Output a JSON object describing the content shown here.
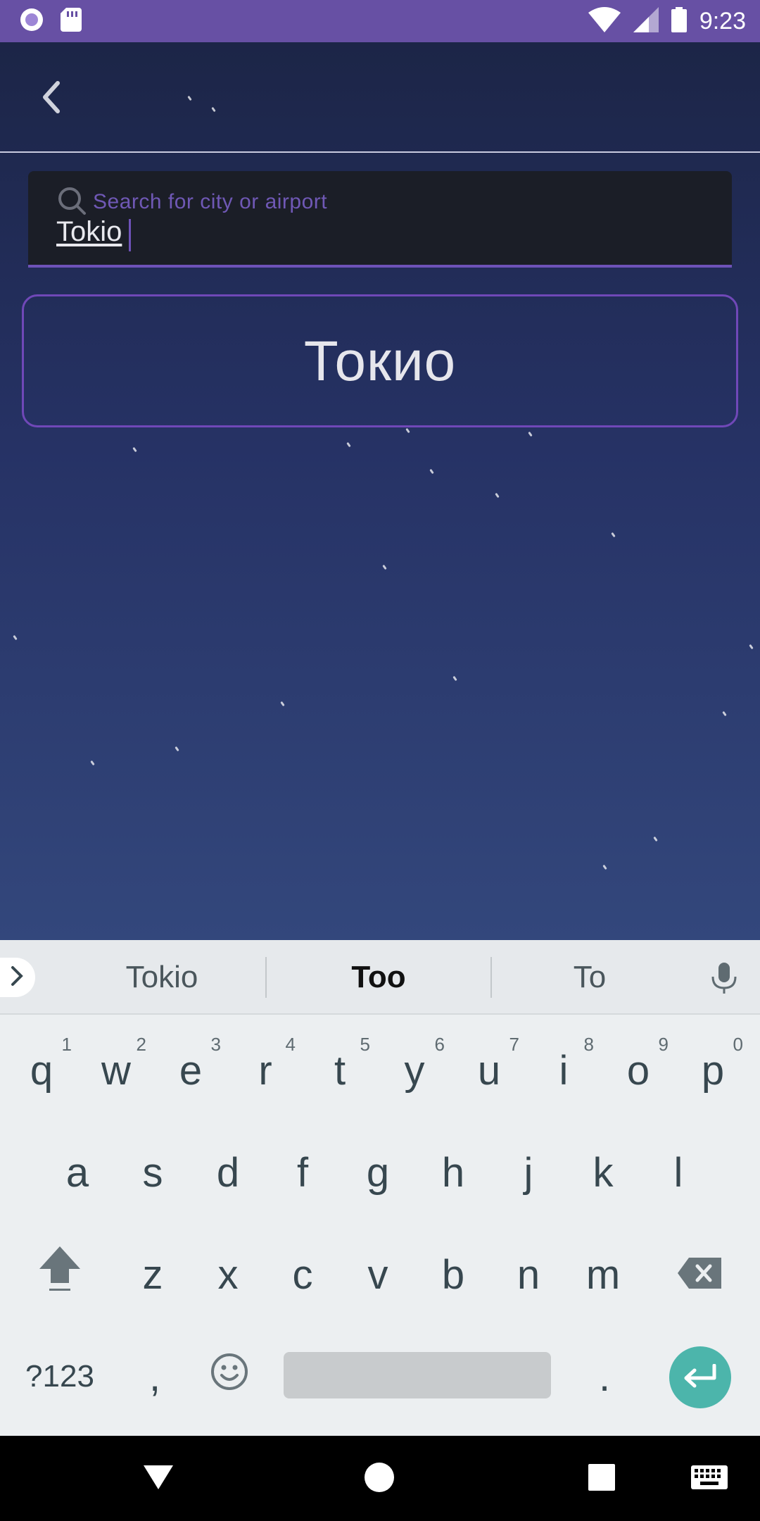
{
  "status_bar": {
    "time": "9:23"
  },
  "header": {
    "back_icon": "chevron-left-icon"
  },
  "search": {
    "placeholder": "Search for city or airport",
    "value": "Tokio"
  },
  "results": [
    {
      "label": "Токио"
    }
  ],
  "keyboard": {
    "suggestions": [
      "Tokio",
      "Too",
      "To"
    ],
    "row1": [
      {
        "k": "q",
        "h": "1"
      },
      {
        "k": "w",
        "h": "2"
      },
      {
        "k": "e",
        "h": "3"
      },
      {
        "k": "r",
        "h": "4"
      },
      {
        "k": "t",
        "h": "5"
      },
      {
        "k": "y",
        "h": "6"
      },
      {
        "k": "u",
        "h": "7"
      },
      {
        "k": "i",
        "h": "8"
      },
      {
        "k": "o",
        "h": "9"
      },
      {
        "k": "p",
        "h": "0"
      }
    ],
    "row2": [
      "a",
      "s",
      "d",
      "f",
      "g",
      "h",
      "j",
      "k",
      "l"
    ],
    "row3": [
      "z",
      "x",
      "c",
      "v",
      "b",
      "n",
      "m"
    ],
    "symbols_label": "?123",
    "comma": ",",
    "period": ".",
    "accent_color": "#4cb5ab"
  },
  "colors": {
    "status_bar": "#6750a4",
    "accent": "#6e52b8"
  }
}
